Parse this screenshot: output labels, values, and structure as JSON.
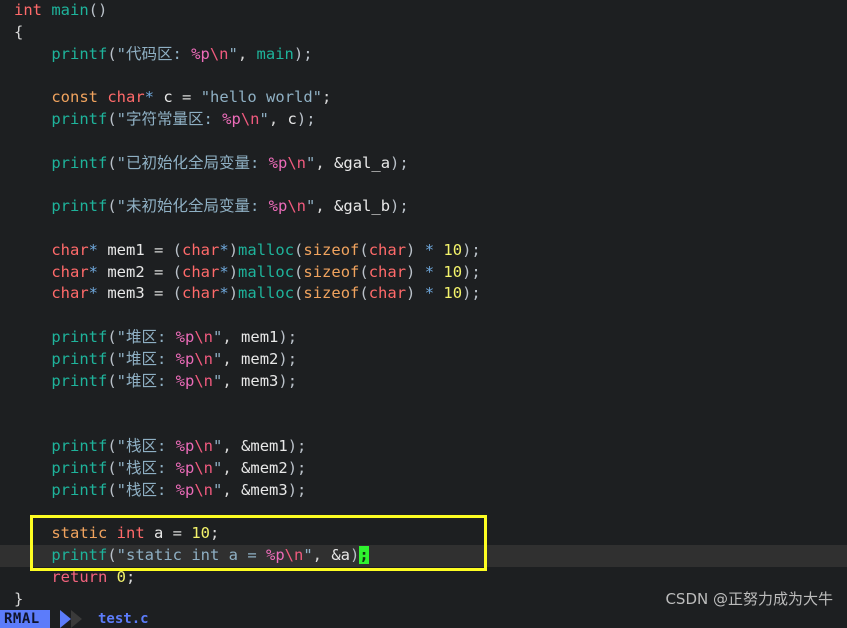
{
  "app": {
    "kind": "terminal-code-editor",
    "filename": "test.c",
    "mode": "RMAL",
    "background": "#1d1f21",
    "highlight_box_color": "#fdfd22",
    "cursor_color": "#2ff22f",
    "current_line_bg": "#303030"
  },
  "code": {
    "lines": [
      {
        "indent": 0,
        "tokens": [
          {
            "t": "int",
            "c": "kw-type"
          },
          {
            "t": " ",
            "c": "pun"
          },
          {
            "t": "main",
            "c": "fn"
          },
          {
            "t": "()",
            "c": "paren"
          }
        ]
      },
      {
        "indent": 0,
        "tokens": [
          {
            "t": "{",
            "c": "pun"
          }
        ]
      },
      {
        "indent": 1,
        "tokens": [
          {
            "t": "printf",
            "c": "fn"
          },
          {
            "t": "(",
            "c": "paren"
          },
          {
            "t": "\"代码区: ",
            "c": "str"
          },
          {
            "t": "%p",
            "c": "fmt"
          },
          {
            "t": "\\n",
            "c": "esc"
          },
          {
            "t": "\"",
            "c": "str"
          },
          {
            "t": ", ",
            "c": "pun"
          },
          {
            "t": "main",
            "c": "fn"
          },
          {
            "t": ");",
            "c": "paren"
          }
        ]
      },
      {
        "indent": 0,
        "tokens": []
      },
      {
        "indent": 1,
        "tokens": [
          {
            "t": "const",
            "c": "kw-mod"
          },
          {
            "t": " ",
            "c": "pun"
          },
          {
            "t": "char",
            "c": "kw-type"
          },
          {
            "t": "*",
            "c": "star"
          },
          {
            "t": " c ",
            "c": "ident"
          },
          {
            "t": "=",
            "c": "pun"
          },
          {
            "t": " ",
            "c": "pun"
          },
          {
            "t": "\"hello world\"",
            "c": "str"
          },
          {
            "t": ";",
            "c": "pun"
          }
        ]
      },
      {
        "indent": 1,
        "tokens": [
          {
            "t": "printf",
            "c": "fn"
          },
          {
            "t": "(",
            "c": "paren"
          },
          {
            "t": "\"字符常量区: ",
            "c": "str"
          },
          {
            "t": "%p",
            "c": "fmt"
          },
          {
            "t": "\\n",
            "c": "esc"
          },
          {
            "t": "\"",
            "c": "str"
          },
          {
            "t": ", ",
            "c": "pun"
          },
          {
            "t": "c",
            "c": "ident"
          },
          {
            "t": ");",
            "c": "paren"
          }
        ]
      },
      {
        "indent": 0,
        "tokens": []
      },
      {
        "indent": 1,
        "tokens": [
          {
            "t": "printf",
            "c": "fn"
          },
          {
            "t": "(",
            "c": "paren"
          },
          {
            "t": "\"已初始化全局变量: ",
            "c": "str"
          },
          {
            "t": "%p",
            "c": "fmt"
          },
          {
            "t": "\\n",
            "c": "esc"
          },
          {
            "t": "\"",
            "c": "str"
          },
          {
            "t": ", ",
            "c": "pun"
          },
          {
            "t": "&gal_a",
            "c": "ident"
          },
          {
            "t": ");",
            "c": "paren"
          }
        ]
      },
      {
        "indent": 0,
        "tokens": []
      },
      {
        "indent": 1,
        "tokens": [
          {
            "t": "printf",
            "c": "fn"
          },
          {
            "t": "(",
            "c": "paren"
          },
          {
            "t": "\"未初始化全局变量: ",
            "c": "str"
          },
          {
            "t": "%p",
            "c": "fmt"
          },
          {
            "t": "\\n",
            "c": "esc"
          },
          {
            "t": "\"",
            "c": "str"
          },
          {
            "t": ", ",
            "c": "pun"
          },
          {
            "t": "&gal_b",
            "c": "ident"
          },
          {
            "t": ");",
            "c": "paren"
          }
        ]
      },
      {
        "indent": 0,
        "tokens": []
      },
      {
        "indent": 1,
        "tokens": [
          {
            "t": "char",
            "c": "kw-type"
          },
          {
            "t": "*",
            "c": "star"
          },
          {
            "t": " mem1 ",
            "c": "ident"
          },
          {
            "t": "= ",
            "c": "pun"
          },
          {
            "t": "(",
            "c": "paren"
          },
          {
            "t": "char",
            "c": "kw-type"
          },
          {
            "t": "*",
            "c": "star"
          },
          {
            "t": ")",
            "c": "paren"
          },
          {
            "t": "malloc",
            "c": "fn"
          },
          {
            "t": "(",
            "c": "paren"
          },
          {
            "t": "sizeof",
            "c": "kw-mod"
          },
          {
            "t": "(",
            "c": "paren"
          },
          {
            "t": "char",
            "c": "kw-type"
          },
          {
            "t": ")",
            "c": "paren"
          },
          {
            "t": " ",
            "c": "pun"
          },
          {
            "t": "*",
            "c": "star"
          },
          {
            "t": " ",
            "c": "pun"
          },
          {
            "t": "10",
            "c": "num"
          },
          {
            "t": ");",
            "c": "paren"
          }
        ]
      },
      {
        "indent": 1,
        "tokens": [
          {
            "t": "char",
            "c": "kw-type"
          },
          {
            "t": "*",
            "c": "star"
          },
          {
            "t": " mem2 ",
            "c": "ident"
          },
          {
            "t": "= ",
            "c": "pun"
          },
          {
            "t": "(",
            "c": "paren"
          },
          {
            "t": "char",
            "c": "kw-type"
          },
          {
            "t": "*",
            "c": "star"
          },
          {
            "t": ")",
            "c": "paren"
          },
          {
            "t": "malloc",
            "c": "fn"
          },
          {
            "t": "(",
            "c": "paren"
          },
          {
            "t": "sizeof",
            "c": "kw-mod"
          },
          {
            "t": "(",
            "c": "paren"
          },
          {
            "t": "char",
            "c": "kw-type"
          },
          {
            "t": ")",
            "c": "paren"
          },
          {
            "t": " ",
            "c": "pun"
          },
          {
            "t": "*",
            "c": "star"
          },
          {
            "t": " ",
            "c": "pun"
          },
          {
            "t": "10",
            "c": "num"
          },
          {
            "t": ");",
            "c": "paren"
          }
        ]
      },
      {
        "indent": 1,
        "tokens": [
          {
            "t": "char",
            "c": "kw-type"
          },
          {
            "t": "*",
            "c": "star"
          },
          {
            "t": " mem3 ",
            "c": "ident"
          },
          {
            "t": "= ",
            "c": "pun"
          },
          {
            "t": "(",
            "c": "paren"
          },
          {
            "t": "char",
            "c": "kw-type"
          },
          {
            "t": "*",
            "c": "star"
          },
          {
            "t": ")",
            "c": "paren"
          },
          {
            "t": "malloc",
            "c": "fn"
          },
          {
            "t": "(",
            "c": "paren"
          },
          {
            "t": "sizeof",
            "c": "kw-mod"
          },
          {
            "t": "(",
            "c": "paren"
          },
          {
            "t": "char",
            "c": "kw-type"
          },
          {
            "t": ")",
            "c": "paren"
          },
          {
            "t": " ",
            "c": "pun"
          },
          {
            "t": "*",
            "c": "star"
          },
          {
            "t": " ",
            "c": "pun"
          },
          {
            "t": "10",
            "c": "num"
          },
          {
            "t": ");",
            "c": "paren"
          }
        ]
      },
      {
        "indent": 0,
        "tokens": []
      },
      {
        "indent": 1,
        "tokens": [
          {
            "t": "printf",
            "c": "fn"
          },
          {
            "t": "(",
            "c": "paren"
          },
          {
            "t": "\"堆区: ",
            "c": "str"
          },
          {
            "t": "%p",
            "c": "fmt"
          },
          {
            "t": "\\n",
            "c": "esc"
          },
          {
            "t": "\"",
            "c": "str"
          },
          {
            "t": ", ",
            "c": "pun"
          },
          {
            "t": "mem1",
            "c": "ident"
          },
          {
            "t": ");",
            "c": "paren"
          }
        ]
      },
      {
        "indent": 1,
        "tokens": [
          {
            "t": "printf",
            "c": "fn"
          },
          {
            "t": "(",
            "c": "paren"
          },
          {
            "t": "\"堆区: ",
            "c": "str"
          },
          {
            "t": "%p",
            "c": "fmt"
          },
          {
            "t": "\\n",
            "c": "esc"
          },
          {
            "t": "\"",
            "c": "str"
          },
          {
            "t": ", ",
            "c": "pun"
          },
          {
            "t": "mem2",
            "c": "ident"
          },
          {
            "t": ");",
            "c": "paren"
          }
        ]
      },
      {
        "indent": 1,
        "tokens": [
          {
            "t": "printf",
            "c": "fn"
          },
          {
            "t": "(",
            "c": "paren"
          },
          {
            "t": "\"堆区: ",
            "c": "str"
          },
          {
            "t": "%p",
            "c": "fmt"
          },
          {
            "t": "\\n",
            "c": "esc"
          },
          {
            "t": "\"",
            "c": "str"
          },
          {
            "t": ", ",
            "c": "pun"
          },
          {
            "t": "mem3",
            "c": "ident"
          },
          {
            "t": ");",
            "c": "paren"
          }
        ]
      },
      {
        "indent": 0,
        "tokens": []
      },
      {
        "indent": 0,
        "tokens": []
      },
      {
        "indent": 1,
        "tokens": [
          {
            "t": "printf",
            "c": "fn"
          },
          {
            "t": "(",
            "c": "paren"
          },
          {
            "t": "\"栈区: ",
            "c": "str"
          },
          {
            "t": "%p",
            "c": "fmt"
          },
          {
            "t": "\\n",
            "c": "esc"
          },
          {
            "t": "\"",
            "c": "str"
          },
          {
            "t": ", ",
            "c": "pun"
          },
          {
            "t": "&mem1",
            "c": "ident"
          },
          {
            "t": ");",
            "c": "paren"
          }
        ]
      },
      {
        "indent": 1,
        "tokens": [
          {
            "t": "printf",
            "c": "fn"
          },
          {
            "t": "(",
            "c": "paren"
          },
          {
            "t": "\"栈区: ",
            "c": "str"
          },
          {
            "t": "%p",
            "c": "fmt"
          },
          {
            "t": "\\n",
            "c": "esc"
          },
          {
            "t": "\"",
            "c": "str"
          },
          {
            "t": ", ",
            "c": "pun"
          },
          {
            "t": "&mem2",
            "c": "ident"
          },
          {
            "t": ");",
            "c": "paren"
          }
        ]
      },
      {
        "indent": 1,
        "tokens": [
          {
            "t": "printf",
            "c": "fn"
          },
          {
            "t": "(",
            "c": "paren"
          },
          {
            "t": "\"栈区: ",
            "c": "str"
          },
          {
            "t": "%p",
            "c": "fmt"
          },
          {
            "t": "\\n",
            "c": "esc"
          },
          {
            "t": "\"",
            "c": "str"
          },
          {
            "t": ", ",
            "c": "pun"
          },
          {
            "t": "&mem3",
            "c": "ident"
          },
          {
            "t": ");",
            "c": "paren"
          }
        ]
      },
      {
        "indent": 0,
        "tokens": []
      },
      {
        "indent": 1,
        "tokens": [
          {
            "t": "static",
            "c": "kw-mod"
          },
          {
            "t": " ",
            "c": "pun"
          },
          {
            "t": "int",
            "c": "kw-type"
          },
          {
            "t": " a ",
            "c": "ident"
          },
          {
            "t": "= ",
            "c": "pun"
          },
          {
            "t": "10",
            "c": "num"
          },
          {
            "t": ";",
            "c": "pun"
          }
        ]
      },
      {
        "indent": 1,
        "current": true,
        "tokens": [
          {
            "t": "printf",
            "c": "fn"
          },
          {
            "t": "(",
            "c": "paren"
          },
          {
            "t": "\"static int a = ",
            "c": "str"
          },
          {
            "t": "%p",
            "c": "fmt"
          },
          {
            "t": "\\n",
            "c": "esc"
          },
          {
            "t": "\"",
            "c": "str"
          },
          {
            "t": ", ",
            "c": "pun"
          },
          {
            "t": "&a",
            "c": "ident"
          },
          {
            "t": ")",
            "c": "paren"
          },
          {
            "t": ";",
            "c": "cursor"
          }
        ]
      },
      {
        "indent": 1,
        "tokens": [
          {
            "t": "return",
            "c": "ret"
          },
          {
            "t": " ",
            "c": "pun"
          },
          {
            "t": "0",
            "c": "num"
          },
          {
            "t": ";",
            "c": "pun"
          }
        ]
      },
      {
        "indent": 0,
        "tokens": [
          {
            "t": "}",
            "c": "pun"
          }
        ]
      }
    ]
  },
  "watermark": {
    "text": "CSDN @正努力成为大牛"
  }
}
